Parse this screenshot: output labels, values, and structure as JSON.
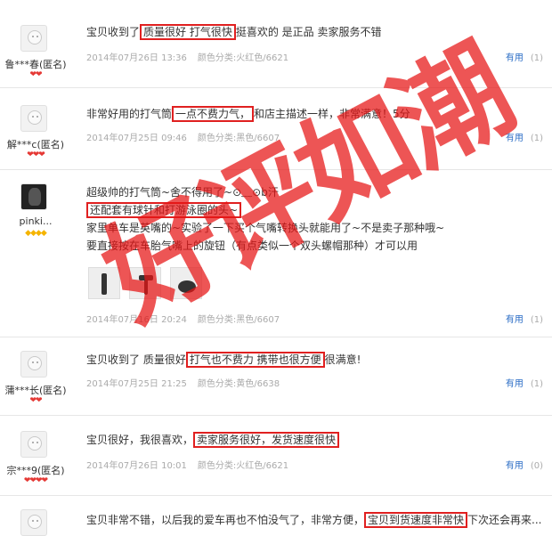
{
  "watermark": "好评如潮",
  "colors": {
    "highlight": "#e02020",
    "link": "#2a6cc5",
    "badge_red": "#e53935",
    "badge_gold": "#f5b400"
  },
  "useful_label": "有用",
  "reviews": [
    {
      "username": "鲁***春(匿名)",
      "badges": "❤❤",
      "text_before": "宝贝收到了",
      "highlight": "质量很好 打气很快",
      "text_after": "挺喜欢的 是正品 卖家服务不错",
      "date": "2014年07月26日 13:36",
      "variant": "颜色分类:火红色/6621",
      "useful_count": "(1)"
    },
    {
      "username": "解***c(匿名)",
      "badges": "❤❤❤",
      "text_before": "非常好用的打气筒",
      "highlight": "一点不费力气，",
      "text_after": "和店主描述一样，非常满意！5分",
      "date": "2014年07月25日 09:46",
      "variant": "颜色分类:黑色/6607",
      "useful_count": "(1)"
    },
    {
      "username": "pinki...",
      "badges": "◆◆◆◆",
      "line1": "超级帅的打气筒~舍不得用了~⊙﹏⊙b汗",
      "highlight": "还配套有球针和打游泳圈的头~",
      "line3": "家里单车是英嘴的~实验了一下买个气嘴转换头就能用了~不是卖子那种哦~",
      "line4": "要直接按在车胎气嘴上的旋钮（有点类似一个双头螺帽那种）才可以用",
      "date": "2014年07月16日 20:24",
      "variant": "颜色分类:黑色/6607",
      "useful_count": "(1)"
    },
    {
      "username": "蒲***长(匿名)",
      "badges": "❤❤",
      "text_before": "宝贝收到了 质量很好",
      "highlight": "打气也不费力 携带也很方便",
      "text_after": "很满意!",
      "date": "2014年07月25日 21:25",
      "variant": "颜色分类:黄色/6638",
      "useful_count": "(1)"
    },
    {
      "username": "宗***9(匿名)",
      "badges": "❤❤❤❤",
      "text_before": "宝贝很好，我很喜欢，",
      "highlight": "卖家服务很好，发货速度很快",
      "text_after": "",
      "date": "2014年07月26日 10:01",
      "variant": "颜色分类:火红色/6621",
      "useful_count": "(0)"
    },
    {
      "text_before": "宝贝非常不错，以后我的爱车再也不怕没气了，非常方便，",
      "highlight": "宝贝到货速度非常快",
      "text_after": "下次还会再来..."
    }
  ]
}
